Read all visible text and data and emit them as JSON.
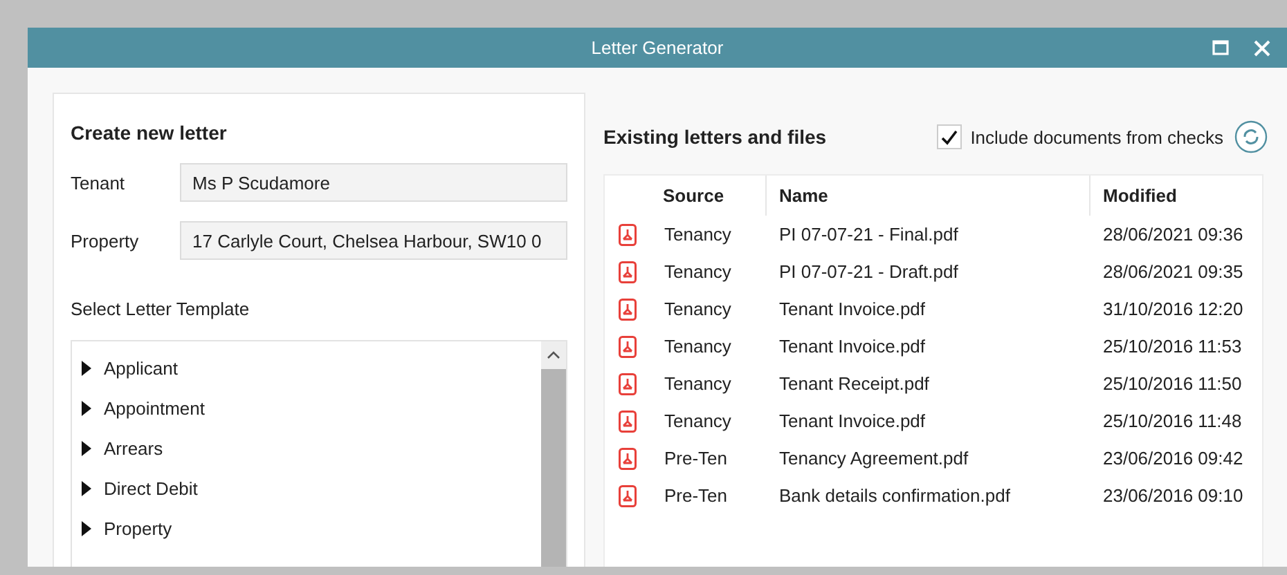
{
  "window": {
    "title": "Letter Generator",
    "controls": [
      {
        "kind": "maximize"
      },
      {
        "kind": "close"
      }
    ]
  },
  "create": {
    "heading": "Create new letter",
    "fields": [
      {
        "label": "Tenant",
        "value": "Ms P Scudamore"
      },
      {
        "label": "Property",
        "value": "17 Carlyle Court, Chelsea Harbour, SW10 0"
      }
    ],
    "template_label": "Select Letter Template",
    "templates": [
      {
        "label": "Applicant",
        "expanded": false
      },
      {
        "label": "Appointment",
        "expanded": false
      },
      {
        "label": "Arrears",
        "expanded": false
      },
      {
        "label": "Direct Debit",
        "expanded": false
      },
      {
        "label": "Property",
        "expanded": false
      }
    ]
  },
  "existing": {
    "heading": "Existing letters and files",
    "include_checks": {
      "label": "Include documents from checks",
      "checked": true
    },
    "table": {
      "columns": [
        "",
        "Source",
        "Name",
        "Modified"
      ],
      "rows": [
        {
          "kind": "pdf",
          "source": "Tenancy",
          "name": "PI 07-07-21 - Final.pdf",
          "modified": "28/06/2021 09:36"
        },
        {
          "kind": "pdf",
          "source": "Tenancy",
          "name": "PI 07-07-21 - Draft.pdf",
          "modified": "28/06/2021 09:35"
        },
        {
          "kind": "pdf",
          "source": "Tenancy",
          "name": "Tenant Invoice.pdf",
          "modified": "31/10/2016 12:20"
        },
        {
          "kind": "pdf",
          "source": "Tenancy",
          "name": "Tenant Invoice.pdf",
          "modified": "25/10/2016 11:53"
        },
        {
          "kind": "pdf",
          "source": "Tenancy",
          "name": "Tenant Receipt.pdf",
          "modified": "25/10/2016 11:50"
        },
        {
          "kind": "pdf",
          "source": "Tenancy",
          "name": "Tenant Invoice.pdf",
          "modified": "25/10/2016 11:48"
        },
        {
          "kind": "pdf",
          "source": "Pre-Ten",
          "name": "Tenancy Agreement.pdf",
          "modified": "23/06/2016 09:42"
        },
        {
          "kind": "pdf",
          "source": "Pre-Ten",
          "name": "Bank details confirmation.pdf",
          "modified": "23/06/2016 09:10"
        }
      ]
    }
  }
}
